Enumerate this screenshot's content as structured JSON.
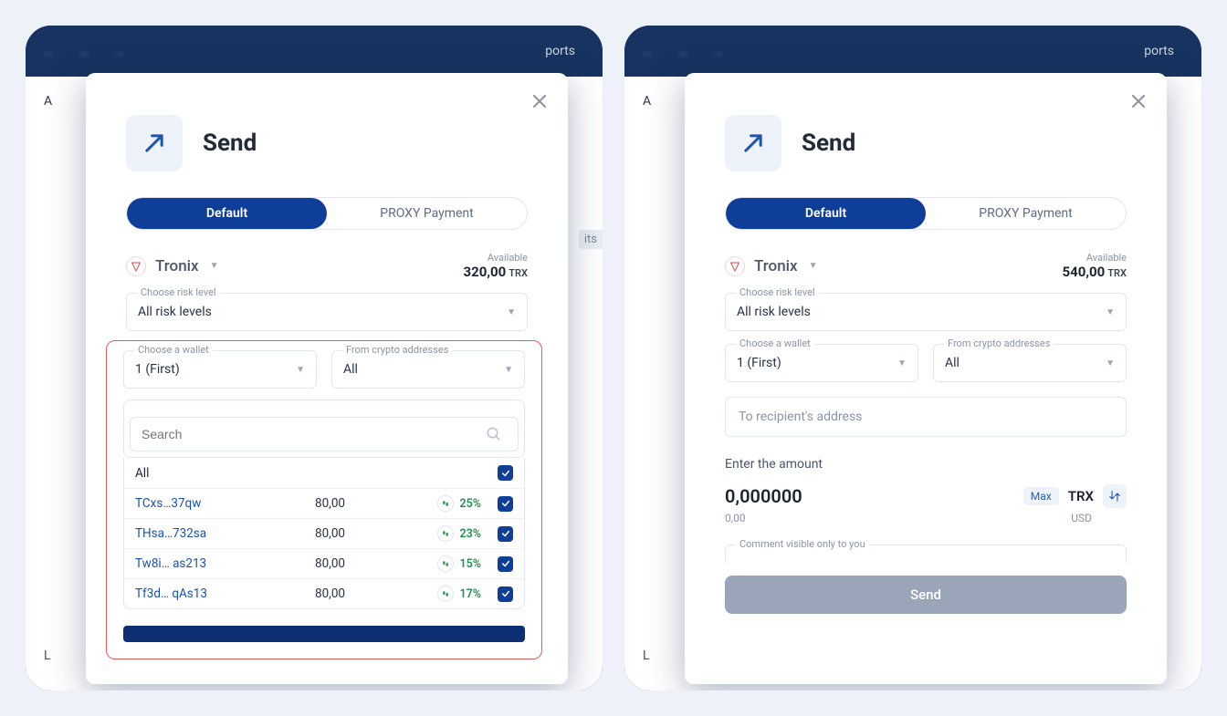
{
  "exports_label": "ports",
  "modal": {
    "title": "Send",
    "tabs": {
      "default": "Default",
      "proxy": "PROXY Payment"
    },
    "currency": "Tronix",
    "available_label": "Available",
    "risk_label": "Choose risk level",
    "risk_value": "All risk levels",
    "wallet_label": "Choose a wallet",
    "wallet_value": "1 (First)",
    "from_label": "From crypto addresses",
    "from_value": "All"
  },
  "left": {
    "available_amount": "320,00",
    "available_sym": "TRX",
    "search_placeholder": "Search",
    "addresses": [
      {
        "addr": "All",
        "amt": "",
        "pct": "",
        "all": true
      },
      {
        "addr": "TCxs…37qw",
        "amt": "80,00",
        "pct": "25%"
      },
      {
        "addr": "THsa…732sa",
        "amt": "80,00",
        "pct": "23%"
      },
      {
        "addr": "Tw8i… as213",
        "amt": "80,00",
        "pct": "15%"
      },
      {
        "addr": "Tf3d…  qAs13",
        "amt": "80,00",
        "pct": "17%"
      }
    ]
  },
  "right": {
    "available_amount": "540,00",
    "available_sym": "TRX",
    "recipient_placeholder": "To recipient's address",
    "enter_amount_label": "Enter the amount",
    "amount": "0,000000",
    "max_label": "Max",
    "currency_main": "TRX",
    "sub_amount": "0,00",
    "sub_currency": "USD",
    "comment_label": "Comment visible only to you",
    "send_button": "Send"
  },
  "behind": {
    "tab": "A",
    "sidetag": "its",
    "bottom": "L"
  }
}
